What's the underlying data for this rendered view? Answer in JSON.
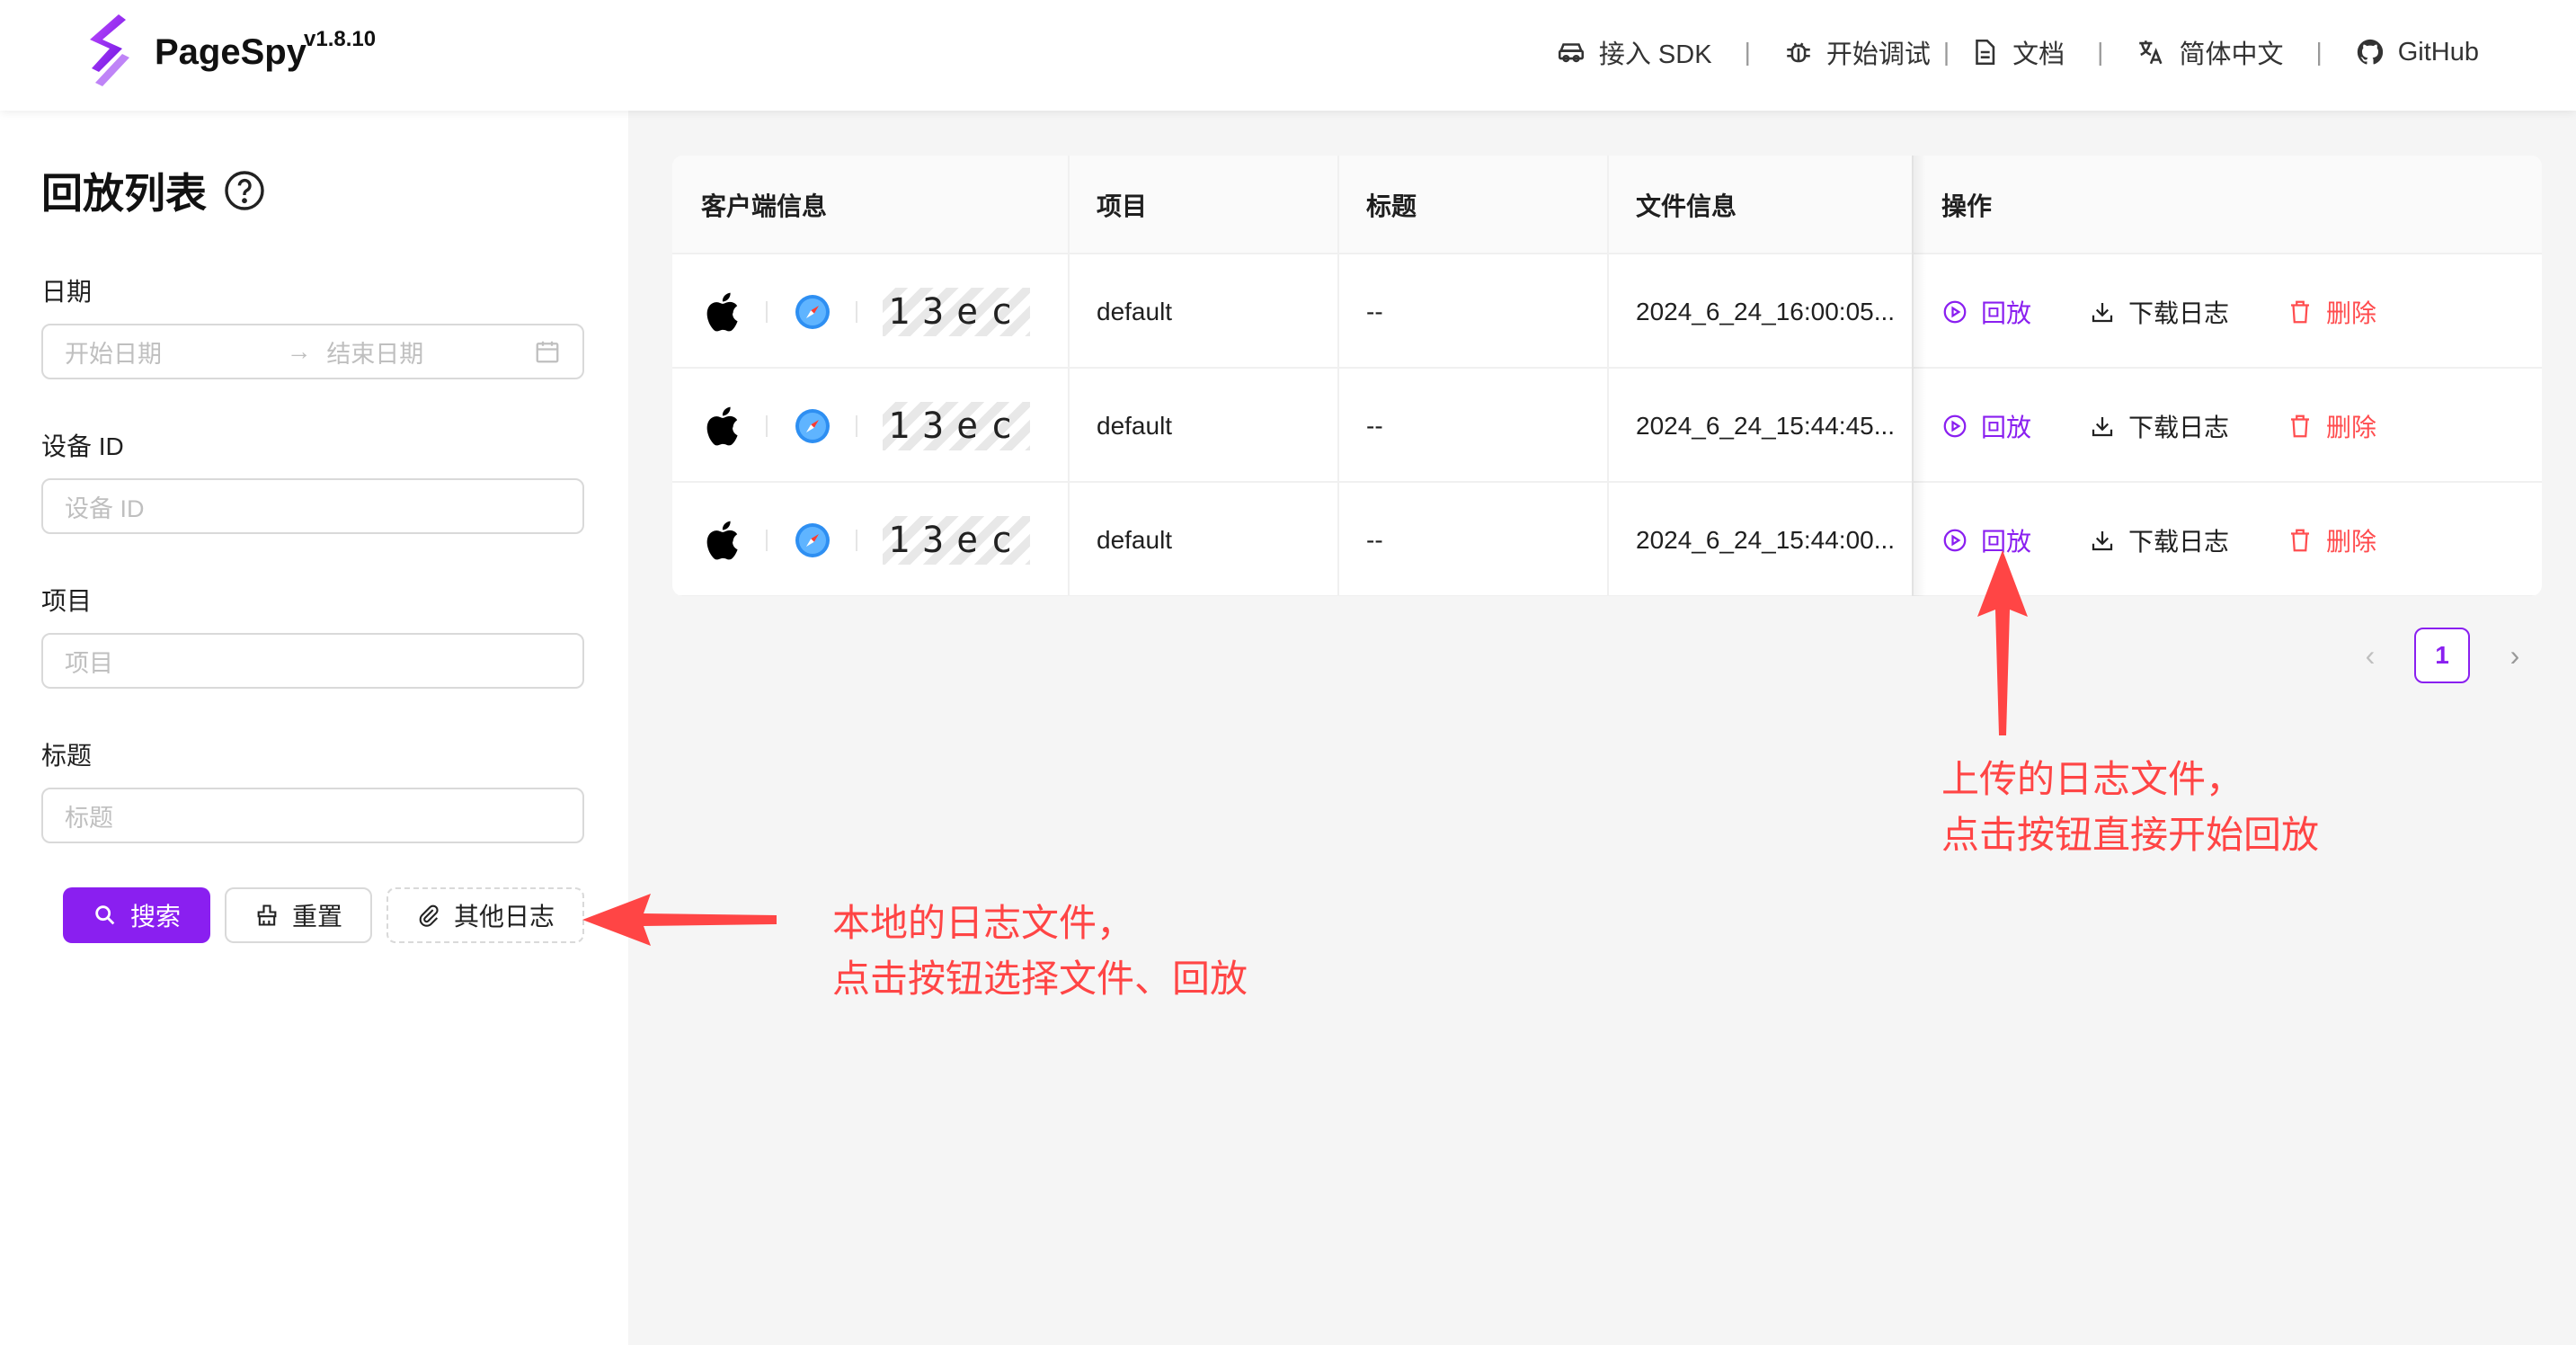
{
  "app": {
    "brand": "PageSpy",
    "version": "v1.8.10"
  },
  "nav": [
    {
      "label": "接入 SDK",
      "icon": "sdk-icon"
    },
    {
      "label": "开始调试",
      "icon": "bug-icon"
    },
    {
      "label": "文档",
      "icon": "document-icon"
    },
    {
      "label": "简体中文",
      "icon": "translate-icon"
    },
    {
      "label": "GitHub",
      "icon": "github-icon"
    }
  ],
  "sidebar": {
    "title": "回放列表",
    "date": {
      "label": "日期",
      "start_placeholder": "开始日期",
      "arrow": "→",
      "end_placeholder": "结束日期"
    },
    "device_id": {
      "label": "设备 ID",
      "placeholder": "设备 ID"
    },
    "project": {
      "label": "项目",
      "placeholder": "项目"
    },
    "title_field": {
      "label": "标题",
      "placeholder": "标题"
    },
    "buttons": {
      "search": "搜索",
      "reset": "重置",
      "other_logs": "其他日志"
    }
  },
  "table": {
    "columns": [
      "客户端信息",
      "项目",
      "标题",
      "文件信息",
      "操作"
    ],
    "rows": [
      {
        "device": "13ec",
        "project": "default",
        "title": "--",
        "file": "2024_6_24_16:00:05..."
      },
      {
        "device": "13ec",
        "project": "default",
        "title": "--",
        "file": "2024_6_24_15:44:45..."
      },
      {
        "device": "13ec",
        "project": "default",
        "title": "--",
        "file": "2024_6_24_15:44:00..."
      }
    ],
    "actions": {
      "replay": "回放",
      "download": "下载日志",
      "delete": "删除"
    }
  },
  "pagination": {
    "prev": "‹",
    "current": "1",
    "next": "›"
  },
  "annotations": {
    "right": {
      "line1": "上传的日志文件，",
      "line2": "点击按钮直接开始回放"
    },
    "left": {
      "line1": "本地的日志文件，",
      "line2": "点击按钮选择文件、回放"
    }
  },
  "colors": {
    "accent": "#8a1ff0",
    "danger": "#ff4d4f",
    "annotation": "#ff4545"
  }
}
